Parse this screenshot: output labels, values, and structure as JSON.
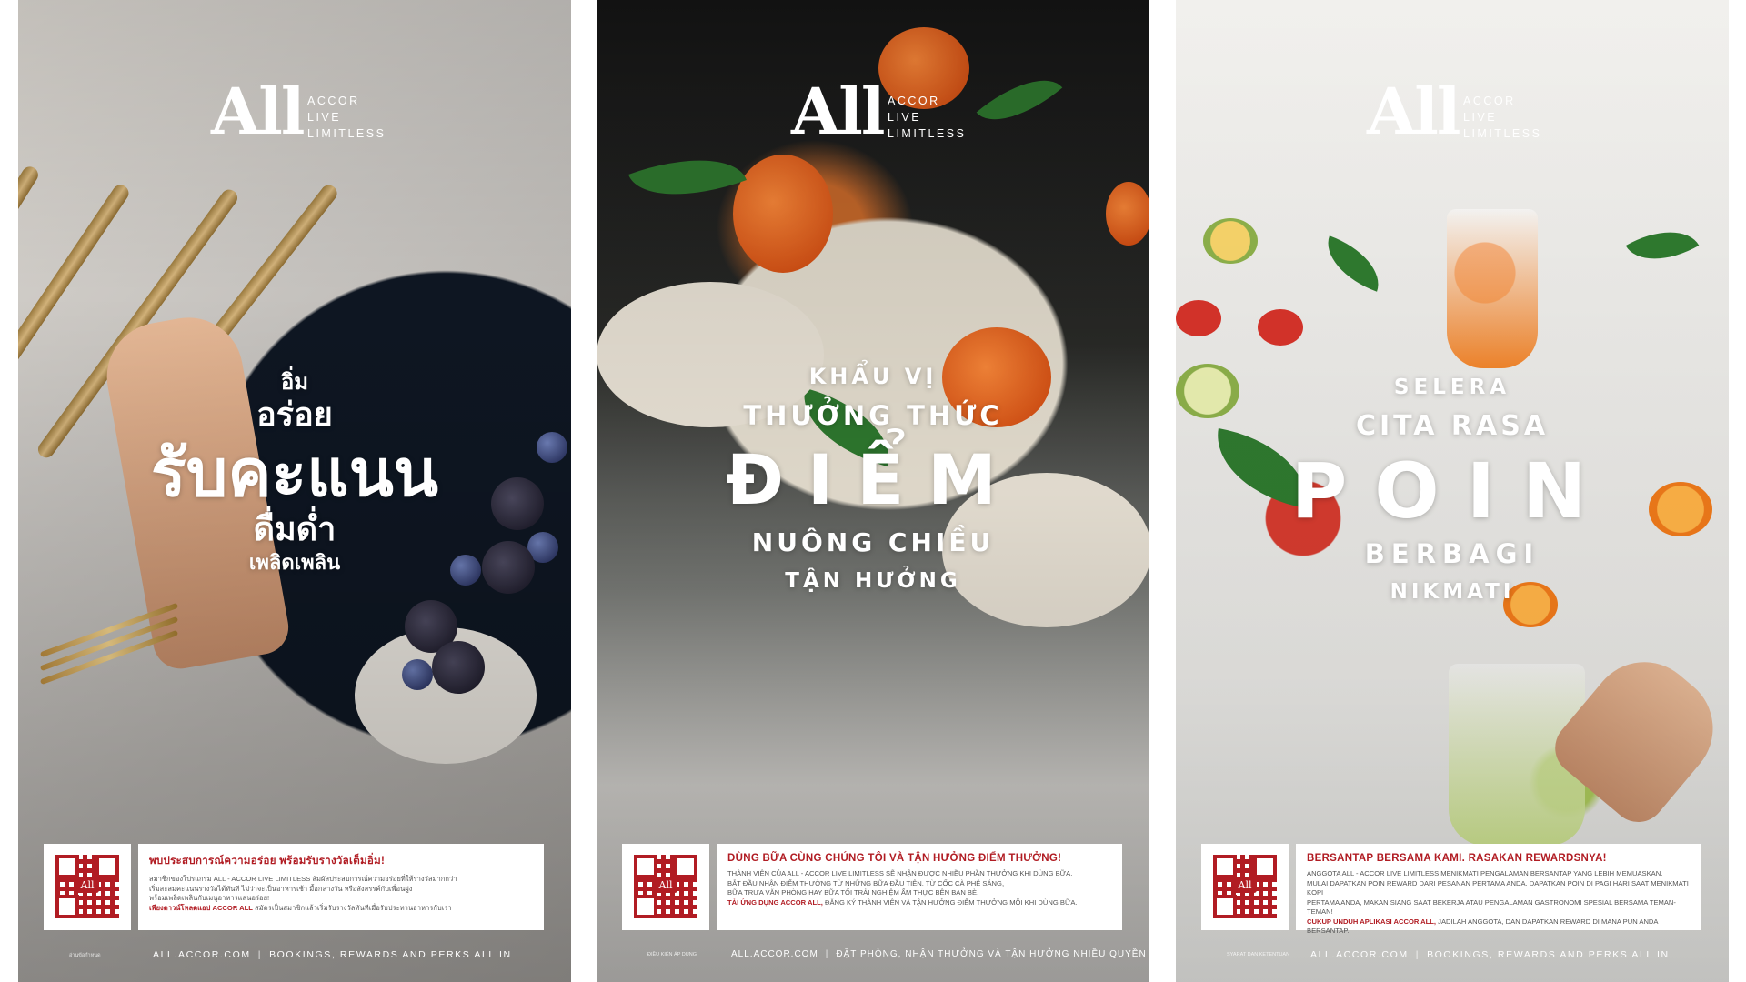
{
  "logo": {
    "mark": "All",
    "line1": "ACCOR",
    "line2": "LIVE",
    "line3": "LIMITLESS"
  },
  "posters": {
    "th": {
      "headline": [
        "อิ่ม",
        "อร่อย",
        "รับคะแนน",
        "ดื่มด่ำ",
        "เพลิดเพลิน"
      ],
      "panel_title": "พบประสบการณ์ความอร่อย พร้อมรับรางวัลเต็มอิ่ม!",
      "panel_body": [
        "สมาชิกของโปรแกรม ALL - ACCOR LIVE LIMITLESS สัมผัสประสบการณ์ความอร่อยที่ให้รางวัลมากกว่า",
        "เริ่มสะสมคะแนนรางวัลได้ทันที ไม่ว่าจะเป็นอาหารเช้า มื้อกลางวัน หรือสังสรรค์กับเพื่อนฝูง",
        "พร้อมเพลิดเพลินกับเมนูอาหารแสนอร่อย!"
      ],
      "panel_cta": "เพียงดาวน์โหลดแอป ACCOR ALL",
      "panel_cta_rest": " สมัครเป็นสมาชิกแล้วเริ่มรับรางวัลทันทีเมื่อรับประทานอาหารกับเรา",
      "footer_small": "อ่านข้อกำหนด",
      "footer_site": "ALL.ACCOR.COM",
      "footer_tagline": "BOOKINGS, REWARDS AND PERKS ALL IN"
    },
    "vi": {
      "headline": [
        "KHẨU VỊ",
        "THƯỞNG THỨC",
        "ĐIỂM",
        "NUÔNG CHIỀU",
        "TẬN HƯỞNG"
      ],
      "panel_title": "DÙNG BỮA CÙNG CHÚNG TÔI VÀ TẬN HƯỞNG ĐIỂM THƯỞNG!",
      "panel_body": [
        "THÀNH VIÊN CỦA ALL - ACCOR LIVE LIMITLESS SẼ NHẬN ĐƯỢC NHIỀU PHẦN THƯỞNG KHI DÙNG BỮA.",
        "BẮT ĐẦU NHẬN ĐIỂM THƯỞNG TỪ NHỮNG BỮA ĐẦU TIÊN. TỪ CỐC CÀ PHÊ SÁNG,",
        "BỮA TRƯA VĂN PHÒNG HAY BỮA TỐI TRẢI NGHIỆM ẨM THỰC BÊN BẠN BÈ."
      ],
      "panel_cta": "TẢI ỨNG DỤNG ACCOR ALL,",
      "panel_cta_rest": " ĐĂNG KÝ THÀNH VIÊN VÀ TẬN HƯỞNG ĐIỂM THƯỞNG MỖI KHI DÙNG BỮA.",
      "footer_small": "ĐIỀU KIỆN ÁP DỤNG",
      "footer_site": "ALL.ACCOR.COM",
      "footer_tagline": "ĐẶT PHÒNG, NHẬN THƯỞNG VÀ TẬN HƯỞNG NHIỀU QUYỀN LỢI"
    },
    "id": {
      "headline": [
        "SELERA",
        "CITA RASA",
        "POIN",
        "BERBAGI",
        "NIKMATI"
      ],
      "panel_title": "BERSANTAP BERSAMA KAMI. RASAKAN REWARDSNYA!",
      "panel_body": [
        "ANGGOTA ALL - ACCOR LIVE LIMITLESS MENIKMATI PENGALAMAN BERSANTAP YANG LEBIH MEMUASKAN.",
        "MULAI DAPATKAN POIN REWARD DARI PESANAN PERTAMA ANDA. DAPATKAN POIN DI PAGI HARI SAAT MENIKMATI KOPI",
        "PERTAMA ANDA, MAKAN SIANG SAAT BEKERJA ATAU PENGALAMAN GASTRONOMI SPESIAL BERSAMA TEMAN-TEMAN!"
      ],
      "panel_cta": "CUKUP UNDUH APLIKASI ACCOR ALL,",
      "panel_cta_rest": " JADILAH ANGGOTA, DAN DAPATKAN REWARD DI MANA PUN ANDA BERSANTAP.",
      "footer_small": "SYARAT DAN KETENTUAN",
      "footer_site": "ALL.ACCOR.COM",
      "footer_tagline": "BOOKINGS, REWARDS AND PERKS ALL IN"
    }
  },
  "colors": {
    "accent_red": "#b11c23",
    "white": "#ffffff"
  }
}
